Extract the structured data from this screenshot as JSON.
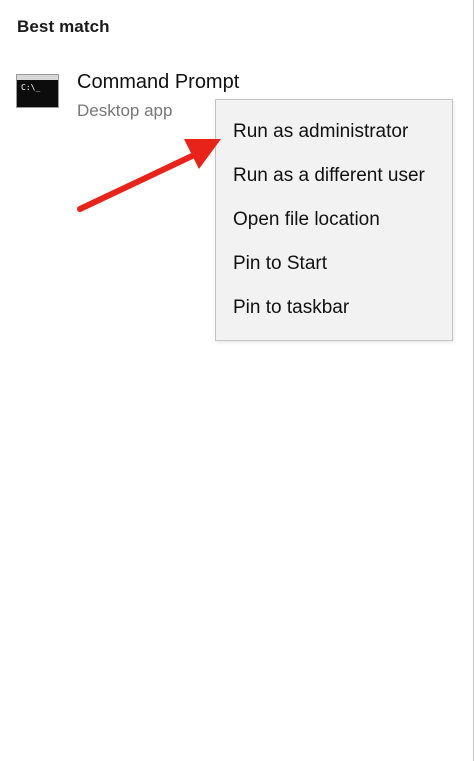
{
  "best_match": {
    "heading": "Best match"
  },
  "result": {
    "icon": "command-prompt-icon",
    "icon_text": "C:\\_",
    "name": "Command Prompt",
    "type": "Desktop app"
  },
  "context_menu": {
    "items": [
      {
        "label": "Run as administrator"
      },
      {
        "label": "Run as a different user"
      },
      {
        "label": "Open file location"
      },
      {
        "label": "Pin to Start"
      },
      {
        "label": "Pin to taskbar"
      }
    ]
  },
  "annotation": {
    "arrow_color": "#e8231a",
    "points_to": "Run as administrator"
  }
}
